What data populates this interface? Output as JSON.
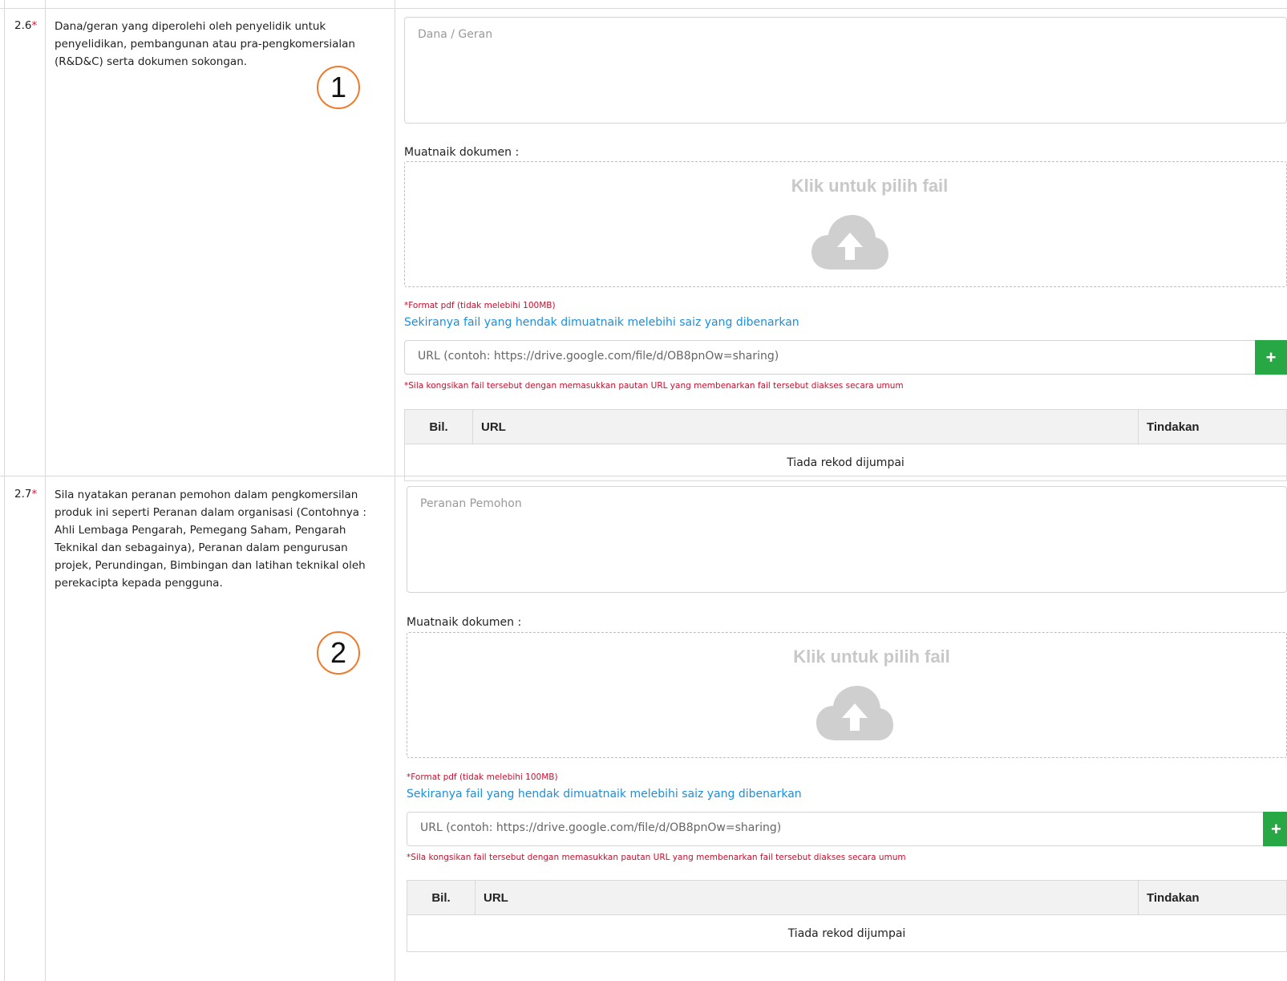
{
  "rows": [
    {
      "number": "2.6",
      "required_mark": "*",
      "question": "Dana/geran yang diperolehi oleh penyelidik untuk penyelidikan, pembangunan atau pra-pengkomersialan (R&D&C) serta dokumen sokongan.",
      "marker": "1",
      "textarea_placeholder": "Dana / Geran",
      "upload_label": "Muatnaik dokumen :",
      "dropzone_text": "Klik untuk pilih fail",
      "format_hint": "*Format pdf (tidak melebihi 100MB)",
      "oversize_link": "Sekiranya fail yang hendak dimuatnaik melebihi saiz yang dibenarkan",
      "url_placeholder": "URL (contoh: https://drive.google.com/file/d/OB8pnOw=sharing)",
      "add_button": "+",
      "share_hint": "*Sila kongsikan fail tersebut dengan memasukkan pautan URL yang membenarkan fail tersebut diakses secara umum",
      "table": {
        "col_no": "Bil.",
        "col_url": "URL",
        "col_action": "Tindakan",
        "empty": "Tiada rekod dijumpai"
      }
    },
    {
      "number": "2.7",
      "required_mark": "*",
      "question": "Sila nyatakan peranan pemohon dalam pengkomersilan produk ini seperti Peranan dalam organisasi (Contohnya : Ahli Lembaga Pengarah, Pemegang Saham, Pengarah Teknikal dan sebagainya), Peranan dalam pengurusan projek, Perundingan, Bimbingan dan latihan teknikal oleh perekacipta kepada pengguna.",
      "marker": "2",
      "textarea_placeholder": "Peranan Pemohon",
      "upload_label": "Muatnaik dokumen :",
      "dropzone_text": "Klik untuk pilih fail",
      "format_hint": "*Format pdf (tidak melebihi 100MB)",
      "oversize_link": "Sekiranya fail yang hendak dimuatnaik melebihi saiz yang dibenarkan",
      "url_placeholder": "URL (contoh: https://drive.google.com/file/d/OB8pnOw=sharing)",
      "add_button": "+",
      "share_hint": "*Sila kongsikan fail tersebut dengan memasukkan pautan URL yang membenarkan fail tersebut diakses secara umum",
      "table": {
        "col_no": "Bil.",
        "col_url": "URL",
        "col_action": "Tindakan",
        "empty": "Tiada rekod dijumpai"
      }
    }
  ],
  "icons": {
    "upload": "cloud-upload-icon",
    "add": "plus-icon",
    "resize": "resize-grip-icon"
  },
  "colors": {
    "required": "#dc143c",
    "link": "#1a8fe0",
    "add_button": "#28a745",
    "marker": "#f07a2c",
    "hint": "#c8102e"
  }
}
